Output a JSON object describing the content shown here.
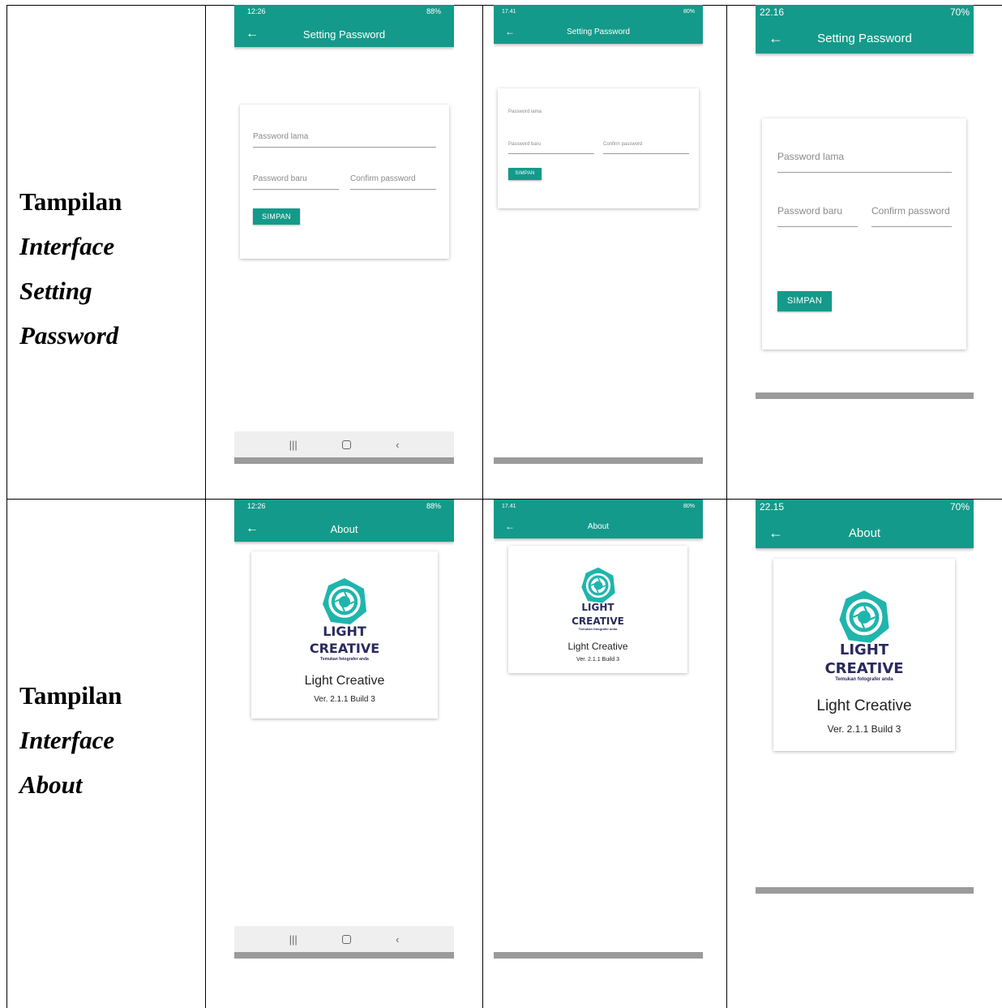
{
  "rows": [
    {
      "label_word": "Tampilan",
      "label_italic": [
        "Interface",
        "Setting",
        "Password"
      ]
    },
    {
      "label_word": "Tampilan",
      "label_italic": [
        "Interface",
        "About"
      ]
    }
  ],
  "setting_screens": [
    {
      "time": "12:26",
      "status_right": "88%",
      "title": "Setting Password",
      "old_password": "Password lama",
      "new_password": "Password baru",
      "confirm_password": "Confirm password",
      "save": "SIMPAN"
    },
    {
      "time": "17.41",
      "status_right": "80%",
      "title": "Setting Password",
      "old_password": "Password lama",
      "new_password": "Password baru",
      "confirm_password": "Confirm password",
      "save": "SIMPAN"
    },
    {
      "time": "22.16",
      "status_right": "70%",
      "title": "Setting Password",
      "old_password": "Password lama",
      "new_password": "Password baru",
      "confirm_password": "Confirm password",
      "save": "SIMPAN"
    }
  ],
  "about_screens": [
    {
      "time": "12:26",
      "status_right": "88%",
      "title": "About",
      "brand_line1": "LIGHT",
      "brand_line2": "CREATIVE",
      "tagline": "Temukan fotografer anda",
      "app_name": "Light Creative",
      "version": "Ver. 2.1.1 Build 3"
    },
    {
      "time": "17.41",
      "status_right": "80%",
      "title": "About",
      "brand_line1": "LIGHT",
      "brand_line2": "CREATIVE",
      "tagline": "Temukan fotografer anda",
      "app_name": "Light Creative",
      "version": "Ver. 2.1.1 Build 3"
    },
    {
      "time": "22.15",
      "status_right": "70%",
      "title": "About",
      "brand_line1": "LIGHT",
      "brand_line2": "CREATIVE",
      "tagline": "Temukan fotografer anda",
      "app_name": "Light Creative",
      "version": "Ver. 2.1.1 Build 3"
    }
  ],
  "icons": {
    "back": "arrow-left-icon",
    "nav_recent": "recent-apps-icon",
    "nav_home": "home-icon",
    "nav_back": "nav-back-icon",
    "logo": "camera-aperture-logo"
  },
  "colors": {
    "appbar": "#149a8a",
    "brand_text": "#2a2a5e",
    "logo": "#1fb5ad"
  }
}
